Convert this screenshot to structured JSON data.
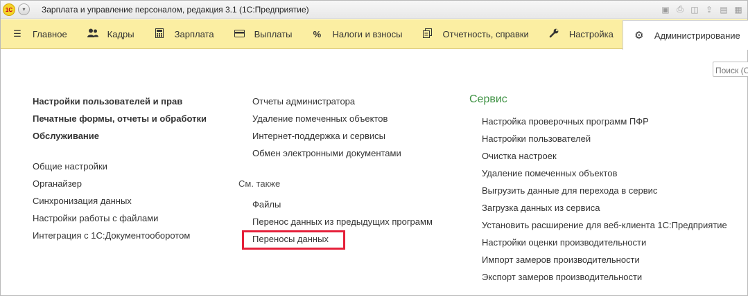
{
  "window": {
    "title": "Зарплата и управление персоналом, редакция 3.1  (1С:Предприятие)",
    "logo_text": "1C",
    "tools": [
      "save-icon",
      "print-icon",
      "preview-icon",
      "upload-icon",
      "attach-icon",
      "more-icon"
    ]
  },
  "sections": [
    {
      "label": "Главное",
      "icon": "menu-icon"
    },
    {
      "label": "Кадры",
      "icon": "people-icon"
    },
    {
      "label": "Зарплата",
      "icon": "calculator-icon"
    },
    {
      "label": "Выплаты",
      "icon": "card-icon"
    },
    {
      "label": "Налоги и взносы",
      "icon": "percent-icon"
    },
    {
      "label": "Отчетность, справки",
      "icon": "documents-icon"
    },
    {
      "label": "Настройка",
      "icon": "wrench-icon"
    },
    {
      "label": "Администрирование",
      "icon": "gear-icon",
      "active": true
    }
  ],
  "search": {
    "placeholder": "Поиск (Ctrl+F)"
  },
  "col1": {
    "bold_items": [
      "Настройки пользователей и прав",
      "Печатные формы, отчеты и обработки",
      "Обслуживание"
    ],
    "items": [
      "Общие настройки",
      "Органайзер",
      "Синхронизация данных",
      "Настройки работы с файлами",
      "Интеграция с 1С:Документооборотом"
    ]
  },
  "col2": {
    "items": [
      "Отчеты администратора",
      "Удаление помеченных объектов",
      "Интернет-поддержка и сервисы",
      "Обмен электронными документами"
    ],
    "see_also_label": "См. также",
    "see_also": [
      "Файлы",
      "Перенос данных из предыдущих программ",
      "Переносы данных"
    ]
  },
  "col3": {
    "title": "Сервис",
    "items": [
      "Настройка проверочных программ ПФР",
      "Настройки пользователей",
      "Очистка настроек",
      "Удаление помеченных объектов",
      "Выгрузить данные для перехода в сервис",
      "Загрузка данных из сервиса",
      "Установить расширение для веб-клиента 1С:Предприятие",
      "Настройки оценки производительности",
      "Импорт замеров производительности",
      "Экспорт замеров производительности"
    ]
  },
  "colors": {
    "sections_bg": "#fbeea2",
    "group_title": "#3d9142",
    "highlight": "#e5203a"
  }
}
